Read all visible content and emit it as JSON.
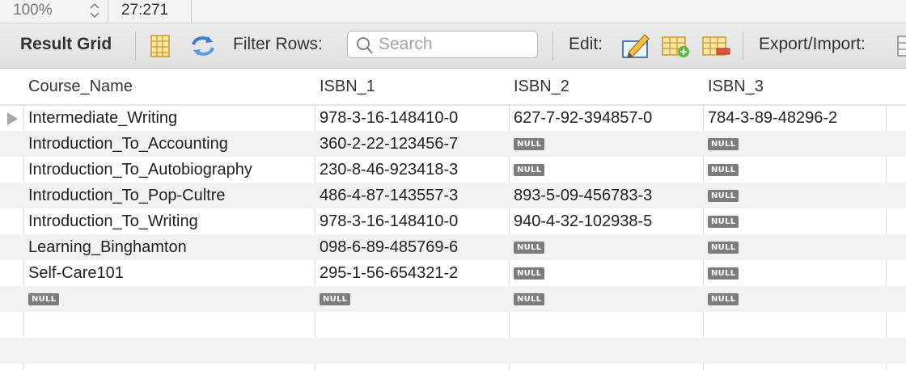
{
  "status": {
    "zoom": "100%",
    "position": "27:271"
  },
  "toolbar": {
    "result_grid": "Result Grid",
    "filter_label": "Filter Rows:",
    "search_placeholder": "Search",
    "edit_label": "Edit:",
    "export_label": "Export/Import:"
  },
  "grid": {
    "null_label": "NULL",
    "columns": [
      "Course_Name",
      "ISBN_1",
      "ISBN_2",
      "ISBN_3"
    ],
    "rows": [
      [
        "Intermediate_Writing",
        "978-3-16-148410-0",
        "627-7-92-394857-0",
        "784-3-89-48296-2"
      ],
      [
        "Introduction_To_Accounting",
        "360-2-22-123456-7",
        "NULL",
        "NULL"
      ],
      [
        "Introduction_To_Autobiography",
        "230-8-46-923418-3",
        "NULL",
        "NULL"
      ],
      [
        "Introduction_To_Pop-Cultre",
        "486-4-87-143557-3",
        "893-5-09-456783-3",
        "NULL"
      ],
      [
        "Introduction_To_Writing",
        "978-3-16-148410-0",
        "940-4-32-102938-5",
        "NULL"
      ],
      [
        "Learning_Binghamton",
        "098-6-89-485769-6",
        "NULL",
        "NULL"
      ],
      [
        "Self-Care101",
        "295-1-56-654321-2",
        "NULL",
        "NULL"
      ],
      [
        "NULL",
        "NULL",
        "NULL",
        "NULL"
      ]
    ]
  }
}
